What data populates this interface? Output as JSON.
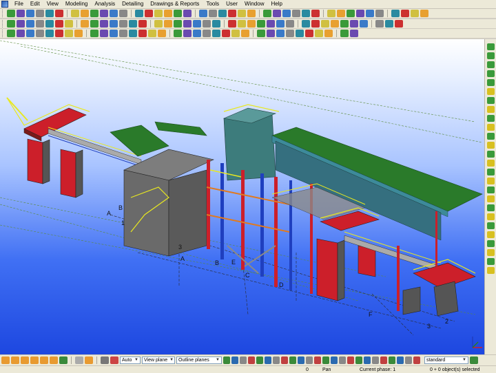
{
  "menu": {
    "items": [
      "File",
      "Edit",
      "View",
      "Modeling",
      "Analysis",
      "Detailing",
      "Drawings & Reports",
      "Tools",
      "User",
      "Window",
      "Help"
    ]
  },
  "viewport": {
    "grid_labels_letters": [
      "A",
      "B",
      "C",
      "D",
      "E",
      "F",
      "A",
      "B",
      "C",
      "D",
      "E"
    ],
    "grid_labels_numbers": [
      "1",
      "2",
      "3",
      "1",
      "2",
      "3"
    ]
  },
  "bottombar": {
    "snap_mode": "Auto",
    "view_plane": "View plane",
    "outline_planes": "Outline planes",
    "standard": "standard"
  },
  "statusbar": {
    "count": "0",
    "mode": "Pan",
    "phase": "Current phase: 1",
    "selection": "0 + 0 object(s) selected"
  },
  "colors": {
    "accent": "#316ac5",
    "column_red": "#cc1f2a",
    "beam_blue": "#1f3fbf",
    "roof_green": "#2a7a2a",
    "railing_yellow": "#e8e820",
    "concrete": "#6a6a6a",
    "silo_teal": "#3d7c7c"
  }
}
